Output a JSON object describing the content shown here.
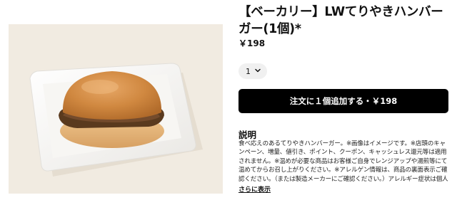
{
  "product": {
    "title": "【ベーカリー】LWてりやきハンバーガー(1個)*",
    "price": "￥198",
    "image_alt": "teriyaki hamburger on white plate"
  },
  "quantity": {
    "selected": "1",
    "icon": "chevron-down-icon"
  },
  "cart": {
    "add_label": "注文に１個追加する・￥198"
  },
  "description": {
    "heading": "説明",
    "body": "食べ応えのあるてりやきハンバーガー。※画像はイメージです。※店頭のキャンペーン、増量、値引き、ポイント、クーポン、キャッシュレス還元等は適用されません。※温めが必要な商品はお客様ご自身でレンジアップや湯煎等にて温めてからお召し上がりください。※アレルゲン情報は、商品の裏面表示ご確認ください。（または製造メーカーにご確認ください。）アレルギー症状は個人差もありますので、最終的なご飲食につきましては、お客様...",
    "more_label": "さらに表示"
  },
  "colors": {
    "button_bg": "#000000",
    "button_text": "#ffffff",
    "image_bg": "#f1ebe1"
  }
}
